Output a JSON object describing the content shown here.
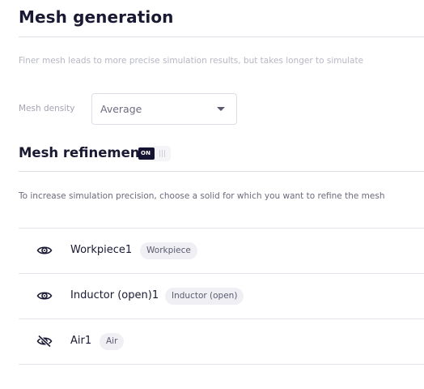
{
  "mesh_generation": {
    "title": "Mesh generation",
    "hint": "Finer mesh leads to more precise simulation results, but takes longer to simulate",
    "density_label": "Mesh density",
    "density_value": "Average"
  },
  "mesh_refinement": {
    "title": "Mesh refinement",
    "toggle_label": "ON",
    "toggle_on": true,
    "description": "To increase simulation precision, choose a solid for which you want to refine the mesh",
    "solids": [
      {
        "name": "Workpiece1",
        "tag": "Workpiece",
        "icon": "eye-icon"
      },
      {
        "name": "Inductor (open)1",
        "tag": "Inductor (open)",
        "icon": "eye-icon"
      },
      {
        "name": "Air1",
        "tag": "Air",
        "icon": "eye-off-icon"
      }
    ]
  }
}
